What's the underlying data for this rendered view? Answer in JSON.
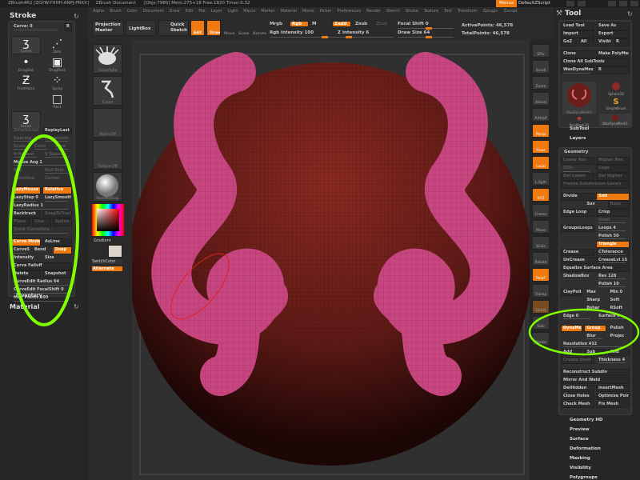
{
  "titlebar": {
    "text": "ZBrush4R2 [ZGYW-YHHH-ANPJ-PRXX]     ZBrush Document      [Objs:7980] Mem:275+18 Free:1820 Timer:0.32",
    "menus": "Menus",
    "script": "DefaultZScript"
  },
  "menubar": [
    "Alpha",
    "Brush",
    "Color",
    "Document",
    "Draw",
    "Edit",
    "File",
    "Layer",
    "Light",
    "Macro",
    "Marker",
    "Material",
    "Movie",
    "Picker",
    "Preferences",
    "Render",
    "Stencil",
    "Stroke",
    "Texture",
    "Tool",
    "Transform",
    "Zplugin",
    "Zscript"
  ],
  "toolbar": {
    "projection_master": "Projection Master",
    "lightbox": "LightBox",
    "quick_sketch": "Quick Sketch",
    "edit": "Edit",
    "draw": "Draw",
    "move": "Move",
    "scale": "Scale",
    "rotate": "Rotate",
    "mrgb": "Mrgb",
    "rgb": "Rgb",
    "m": "M",
    "zadd": "Zadd",
    "zsub": "Zsub",
    "zcut": "Zcut",
    "rgb_intensity": "Rgb Intensity 100",
    "z_intensity": "Z Intensity 6",
    "focal_shift": "Focal Shift 0",
    "draw_size": "Draw Size 64",
    "active_points": "ActivePoints: 46,578",
    "total_points": "TotalPoints: 46,578"
  },
  "stroke": {
    "title": "Stroke",
    "curve": "Curve: 0",
    "r": "R",
    "brushes": [
      "Curve",
      "Dots",
      "DragDot",
      "DragRect",
      "FreeHand",
      "Spray",
      "",
      "Rect",
      "Curve"
    ],
    "rows": [
      [
        {
          "t": "Directional",
          "k": "dim plain"
        },
        {
          "t": "ReplayLast"
        }
      ],
      [
        {
          "t": "Spacing",
          "k": "dim plain slid"
        },
        {
          "t": "Placement",
          "k": "dim plain slid"
        }
      ],
      [
        {
          "t": "Scale",
          "k": "dim plain slid"
        },
        {
          "t": "Color",
          "k": "dim plain slid"
        },
        {
          "t": "Flow",
          "k": "dim plain slid"
        }
      ],
      [
        {
          "t": "H Repeat",
          "k": "dim plain slid"
        },
        {
          "t": "V Repeat",
          "k": "dim plain slid"
        }
      ],
      [
        {
          "t": "Mouse Avg 1",
          "k": "plain slid"
        }
      ],
      [
        {
          "t": "Roll",
          "k": "dim plain"
        },
        {
          "t": "Roll Dist",
          "k": "dim plain slid"
        }
      ],
      [
        {
          "t": "Sensitive",
          "k": "dim plain"
        },
        {
          "t": "Center",
          "k": "dim plain"
        }
      ],
      "gap",
      [
        {
          "t": "LazyMouse",
          "k": "orange"
        },
        {
          "t": "Relative",
          "k": "orange"
        }
      ],
      [
        {
          "t": "LazyStep 0",
          "k": "plain slid"
        },
        {
          "t": "LazySmooth",
          "k": "plain slid"
        }
      ],
      [
        {
          "t": "LazyRadius 1",
          "k": "plain slid"
        }
      ],
      [
        {
          "t": "Backtrack"
        },
        {
          "t": "SnapToTrack",
          "k": "dim"
        }
      ],
      [
        {
          "t": "Plane",
          "k": "dim"
        },
        {
          "t": "Line",
          "k": "dim"
        },
        {
          "t": "Spline Path",
          "k": "dim"
        }
      ],
      [
        {
          "t": "Track Curvature",
          "k": "dim plain slid"
        }
      ],
      "gap",
      [
        {
          "t": "Curve Mode",
          "k": "orange"
        },
        {
          "t": "AsLine"
        }
      ],
      [
        {
          "t": "CurveStep 0.",
          "k": "plain slid"
        },
        {
          "t": "Bend",
          "k": "plain"
        },
        {
          "t": "Snap",
          "k": "orange"
        }
      ],
      [
        {
          "t": "Intensity",
          "k": "plain"
        },
        {
          "t": "Size",
          "k": "plain"
        }
      ],
      [
        {
          "t": "Curve Falloff"
        }
      ],
      [
        {
          "t": "Delete"
        },
        {
          "t": "Snapshot"
        }
      ],
      [
        {
          "t": "CurveEdit Radius 64",
          "k": "plain slid"
        }
      ],
      [
        {
          "t": "CurveEdit FocalShift 0",
          "k": "plain slid"
        }
      ],
      [
        {
          "t": "Max Points 100",
          "k": "plain slid"
        }
      ]
    ],
    "inventory": "Inventory",
    "material": "Material"
  },
  "shelf": {
    "thumbs": [
      "CurveTube",
      "Curve",
      "Alpha Off",
      "Texture Off",
      "StartMatCap"
    ],
    "gradient": "Gradient",
    "switch_color": "SwitchColor",
    "alternate": "Alternate"
  },
  "rightshelf": [
    {
      "t": "SPix",
      "o": false
    },
    {
      "t": "Scroll",
      "o": false
    },
    {
      "t": "Zoom",
      "o": false
    },
    {
      "t": "Actual",
      "o": false
    },
    {
      "t": "AAHalf",
      "o": false
    },
    {
      "t": "Persp",
      "o": true
    },
    {
      "t": "Floor",
      "o": true
    },
    {
      "t": "Local",
      "o": true
    },
    {
      "t": "L.Sym",
      "o": false
    },
    {
      "t": "XYZ",
      "o": true
    },
    {
      "t": "Frame",
      "o": false
    },
    {
      "t": "Move",
      "o": false
    },
    {
      "t": "Scale",
      "o": false
    },
    {
      "t": "Rotate",
      "o": false
    },
    {
      "t": "PolyF",
      "o": true
    },
    {
      "t": "Transp",
      "o": false
    },
    {
      "t": "Ghost",
      "o": false
    },
    {
      "t": "Solo",
      "o": false
    },
    {
      "t": "Xpose",
      "o": false
    }
  ],
  "tool": {
    "title": "Tool",
    "rows": [
      [
        {
          "t": "Load Tool"
        },
        {
          "t": "Save As"
        }
      ],
      [
        {
          "t": "Import"
        },
        {
          "t": "Export"
        }
      ],
      [
        {
          "t": "GoZ"
        },
        {
          "t": "All"
        },
        {
          "t": "Visible"
        },
        {
          "t": "R"
        }
      ],
      "gap",
      [
        {
          "t": "Clone"
        },
        {
          "t": "Make PolyMesh3D"
        }
      ],
      [
        {
          "t": "Clone All SubTools"
        }
      ],
      [
        {
          "t": "WaxDynaMesh 28. 48",
          "k": "slid"
        },
        {
          "t": "R"
        }
      ]
    ],
    "thumbs": [
      "WaxDynaMesh1",
      "Sphere3D",
      "SimpleBrush",
      "PolyMesh3D",
      "WaxDynaMesh1"
    ],
    "subtool": "SubTool",
    "layers": "Layers",
    "geometry": "Geometry",
    "geo_rows": [
      [
        {
          "t": "Lower Res",
          "k": "dim"
        },
        {
          "t": "Higher Res",
          "k": "dim"
        }
      ],
      [
        {
          "t": "SDiv",
          "k": "dim plain slid"
        },
        {
          "t": "Cage",
          "k": "dim"
        }
      ],
      [
        {
          "t": "Del Lower",
          "k": "dim"
        },
        {
          "t": "Del Higher",
          "k": "dim"
        }
      ],
      [
        {
          "t": "Freeze Subdivision Levels",
          "k": "dim"
        }
      ],
      "gap",
      [
        {
          "t": "Divide"
        },
        {
          "t": "Smt",
          "k": "orange"
        }
      ],
      [
        {
          "t": "",
          "k": "plain"
        },
        {
          "t": "Suv",
          "k": "plain"
        },
        {
          "t": "Rsuv",
          "k": "dim"
        }
      ],
      [
        {
          "t": "Edge Loop"
        },
        {
          "t": "Crisp"
        }
      ],
      [
        {
          "t": "",
          "k": "plain"
        },
        {
          "t": "Dsmt",
          "k": "dim plain slid"
        }
      ],
      [
        {
          "t": "GroupsLoops"
        },
        {
          "t": "Loops 4",
          "k": "plain slid"
        }
      ],
      [
        {
          "t": "",
          "k": "plain"
        },
        {
          "t": "Polish 50",
          "k": "plain slid"
        }
      ],
      [
        {
          "t": "",
          "k": "plain"
        },
        {
          "t": "Triangle",
          "k": "orange"
        }
      ],
      [
        {
          "t": "Crease"
        },
        {
          "t": "CTolerance",
          "k": "slid"
        }
      ],
      [
        {
          "t": "UnCrease"
        },
        {
          "t": "CreaseLvl 15",
          "k": "slid"
        }
      ],
      [
        {
          "t": "Equalize Surface Area"
        }
      ],
      [
        {
          "t": "ShadowBox",
          "k": "plain"
        },
        {
          "t": "Res 128",
          "k": "plain slid"
        }
      ],
      [
        {
          "t": "",
          "k": "plain"
        },
        {
          "t": "Polish 10",
          "k": "plain slid"
        }
      ],
      [
        {
          "t": "ClayPolish"
        },
        {
          "t": "Max",
          "k": "plain"
        },
        {
          "t": "Min 0",
          "k": "plain"
        }
      ],
      [
        {
          "t": "",
          "k": "plain"
        },
        {
          "t": "Sharp",
          "k": "plain"
        },
        {
          "t": "Soft",
          "k": "plain"
        }
      ],
      [
        {
          "t": "",
          "k": "plain"
        },
        {
          "t": "Bshar",
          "k": "plain"
        },
        {
          "t": "RSoft",
          "k": "plain"
        }
      ],
      [
        {
          "t": "Edge 0",
          "k": "plain slid"
        },
        {
          "t": "Surface 0",
          "k": "plain slid"
        }
      ],
      "gap",
      [
        {
          "t": "DynaMesh",
          "k": "orange"
        },
        {
          "t": "Group",
          "k": "orange"
        },
        {
          "t": "Polish",
          "k": "plain"
        }
      ],
      [
        {
          "t": "",
          "k": "plain"
        },
        {
          "t": "Blur",
          "k": "plain slid"
        },
        {
          "t": "Projec",
          "k": "plain"
        }
      ],
      [
        {
          "t": "Resolution 432",
          "k": "plain slid"
        }
      ],
      [
        {
          "t": "Add"
        },
        {
          "t": "Sub"
        },
        {
          "t": "And"
        }
      ],
      [
        {
          "t": "Create Shell",
          "k": "dim"
        },
        {
          "t": "Thickness 4",
          "k": "plain slid"
        }
      ],
      "gap",
      [
        {
          "t": "Reconstruct Subdiv"
        }
      ],
      [
        {
          "t": "Mirror And Weld"
        }
      ],
      [
        {
          "t": "DelHidden"
        },
        {
          "t": "InsertMesh"
        }
      ],
      [
        {
          "t": "Close Holes"
        },
        {
          "t": "Optimize Points"
        }
      ],
      [
        {
          "t": "Check Mesh"
        },
        {
          "t": "Fix Mesh"
        }
      ]
    ],
    "sections": [
      "Geometry HD",
      "Preview",
      "Surface",
      "Deformation",
      "Masking",
      "Visibility",
      "Polygroups"
    ]
  },
  "colors": {
    "accent": "#f07a10",
    "highlight": "#7fff00",
    "model": "#d0548f",
    "sphere": "#6b1e1a"
  }
}
